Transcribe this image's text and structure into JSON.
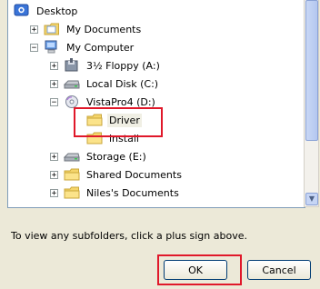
{
  "tree": {
    "items": [
      {
        "label": "Desktop",
        "icon": "desktop-icon",
        "expander": ""
      },
      {
        "label": "My Documents",
        "icon": "my-documents-folder-icon",
        "expander": "+"
      },
      {
        "label": "My Computer",
        "icon": "my-computer-icon",
        "expander": "−"
      },
      {
        "label": "3½ Floppy (A:)",
        "icon": "floppy-drive-icon",
        "expander": "+"
      },
      {
        "label": "Local Disk (C:)",
        "icon": "hard-drive-icon",
        "expander": "+"
      },
      {
        "label": "VistaPro4 (D:)",
        "icon": "cd-drive-icon",
        "expander": "−"
      },
      {
        "label": "Driver",
        "icon": "folder-icon",
        "expander": ""
      },
      {
        "label": "install",
        "icon": "folder-icon",
        "expander": ""
      },
      {
        "label": "Storage (E:)",
        "icon": "hard-drive-icon",
        "expander": "+"
      },
      {
        "label": "Shared Documents",
        "icon": "shared-folder-icon",
        "expander": "+"
      },
      {
        "label": "Niles's Documents",
        "icon": "folder-icon",
        "expander": "+"
      }
    ]
  },
  "info": {
    "text": "To view any subfolders, click a plus sign above."
  },
  "buttons": {
    "ok": "OK",
    "cancel": "Cancel"
  },
  "colors": {
    "highlight": "#e0182a",
    "folder": "#f5d56b",
    "dialog_bg": "#ece9d8"
  }
}
